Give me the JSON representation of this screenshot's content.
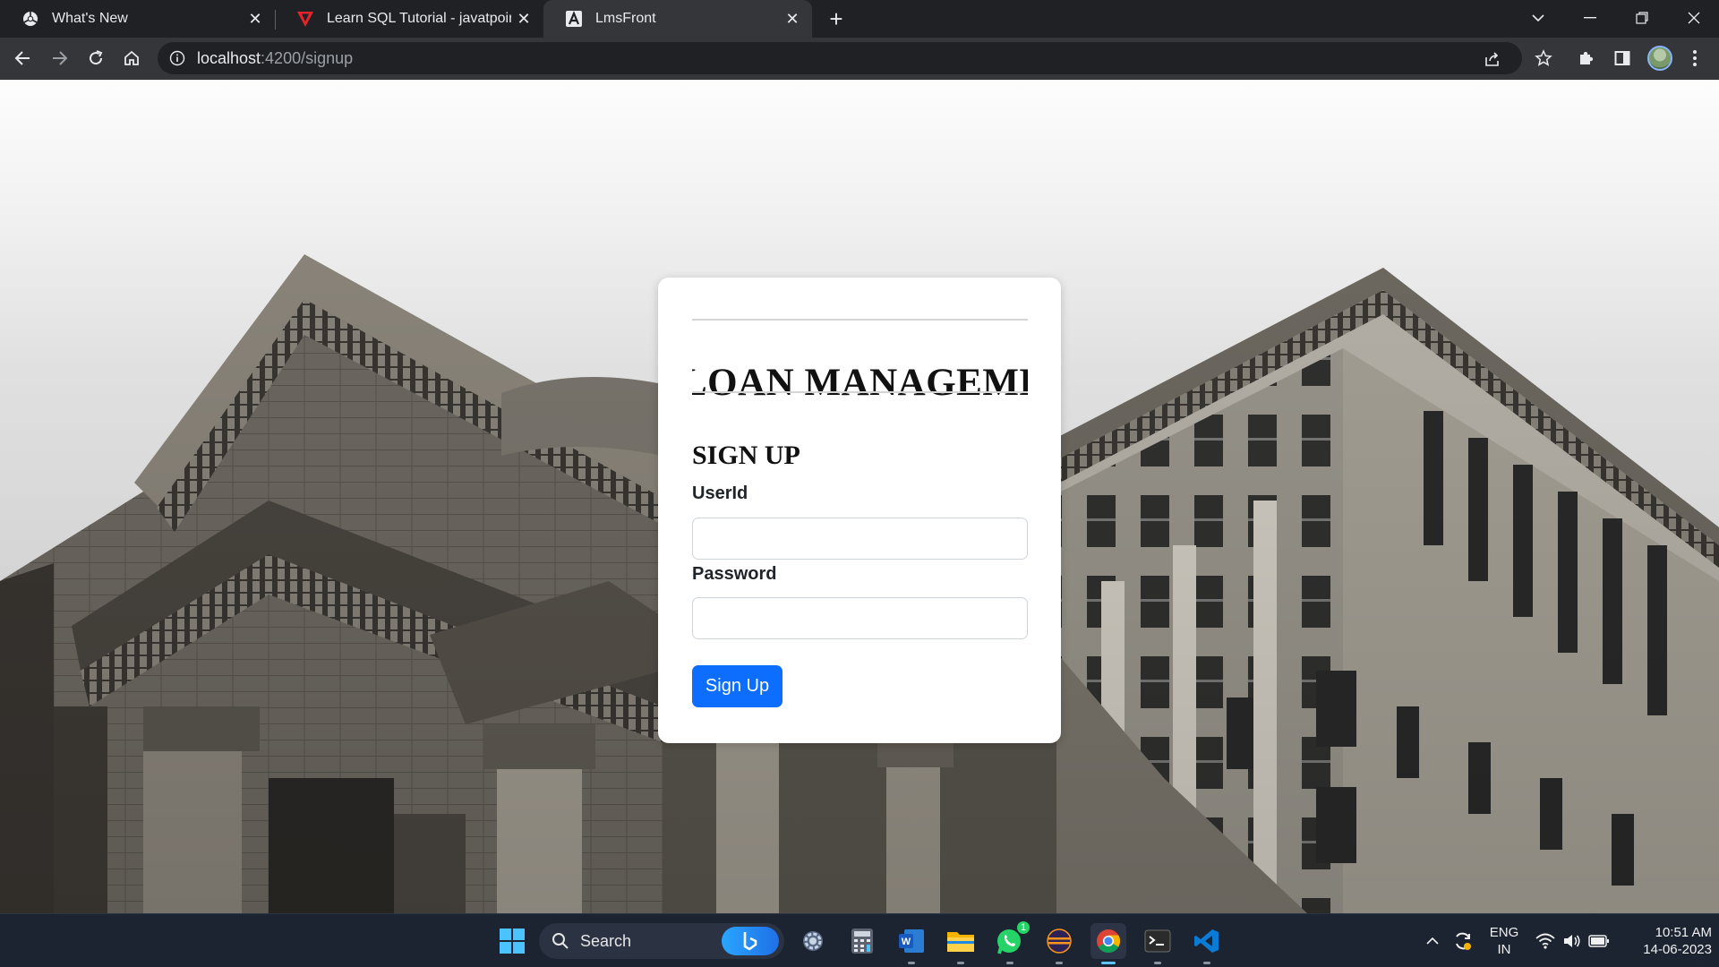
{
  "browser": {
    "tabs": [
      {
        "title": "What's New",
        "favicon": "chrome-icon"
      },
      {
        "title": "Learn SQL Tutorial - javatpoint",
        "favicon": "javatpoint-icon"
      },
      {
        "title": "LmsFront",
        "favicon": "angular-icon"
      }
    ],
    "url_host": "localhost",
    "url_path": ":4200/signup"
  },
  "page": {
    "banner_text": "LOAN MANAGEMENT SYSTEM",
    "heading": "SIGN UP",
    "userid_label": "UserId",
    "userid_value": "",
    "password_label": "Password",
    "password_value": "",
    "submit_label": "Sign Up",
    "accent_color": "#0d6efd"
  },
  "taskbar": {
    "search_label": "Search",
    "whatsapp_badge": "1",
    "lang_top": "ENG",
    "lang_bottom": "IN",
    "time": "10:51 AM",
    "date": "14-06-2023"
  }
}
